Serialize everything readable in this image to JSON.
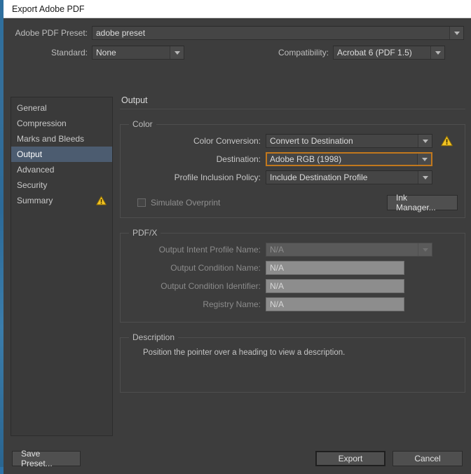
{
  "window": {
    "title": "Export Adobe PDF"
  },
  "preset_bar": {
    "preset_label": "Adobe PDF Preset:",
    "preset_value": "adobe preset",
    "standard_label": "Standard:",
    "standard_value": "None",
    "compatibility_label": "Compatibility:",
    "compatibility_value": "Acrobat 6 (PDF 1.5)"
  },
  "sidebar": {
    "items": [
      {
        "label": "General",
        "selected": false,
        "warning": false
      },
      {
        "label": "Compression",
        "selected": false,
        "warning": false
      },
      {
        "label": "Marks and Bleeds",
        "selected": false,
        "warning": false
      },
      {
        "label": "Output",
        "selected": true,
        "warning": false
      },
      {
        "label": "Advanced",
        "selected": false,
        "warning": false
      },
      {
        "label": "Security",
        "selected": false,
        "warning": false
      },
      {
        "label": "Summary",
        "selected": false,
        "warning": true
      }
    ]
  },
  "content": {
    "heading": "Output",
    "color_group": {
      "legend": "Color",
      "color_conversion_label": "Color Conversion:",
      "color_conversion_value": "Convert to Destination",
      "destination_label": "Destination:",
      "destination_value": "Adobe RGB (1998)",
      "profile_policy_label": "Profile Inclusion Policy:",
      "profile_policy_value": "Include Destination Profile",
      "simulate_overprint_label": "Simulate Overprint",
      "ink_manager_label": "Ink Manager..."
    },
    "pdfx_group": {
      "legend": "PDF/X",
      "output_intent_label": "Output Intent Profile Name:",
      "output_intent_value": "N/A",
      "condition_name_label": "Output Condition Name:",
      "condition_name_value": "N/A",
      "condition_id_label": "Output Condition Identifier:",
      "condition_id_value": "N/A",
      "registry_label": "Registry Name:",
      "registry_value": "N/A"
    },
    "description_group": {
      "legend": "Description",
      "text": "Position the pointer over a heading to view a description."
    }
  },
  "footer": {
    "save_preset_label": "Save Preset...",
    "export_label": "Export",
    "cancel_label": "Cancel"
  },
  "colors": {
    "dialog_bg": "#3d3d3d",
    "selection": "#4c5c70",
    "focus_ring": "#c2781d",
    "warning": "#f2c322"
  }
}
